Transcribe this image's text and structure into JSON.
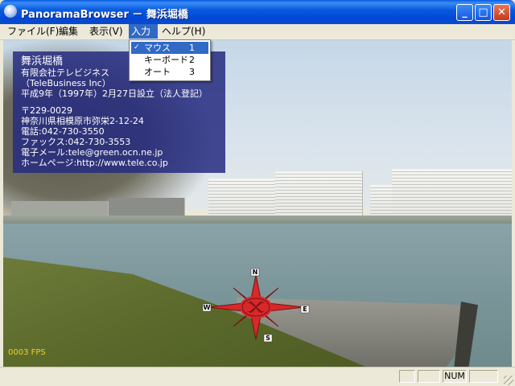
{
  "window": {
    "title": "PanoramaBrowser － 舞浜堀橋",
    "minimize_glyph": "_",
    "maximize_glyph": "□",
    "close_glyph": "✕"
  },
  "menu": {
    "items": [
      {
        "label": "ファイル(F)"
      },
      {
        "label": "編集"
      },
      {
        "label": "表示(V)"
      },
      {
        "label": "入力"
      },
      {
        "label": "ヘルプ(H)"
      }
    ]
  },
  "input_menu": {
    "items": [
      {
        "check": "✓",
        "label": "マウス",
        "key": "1",
        "selected": true
      },
      {
        "check": "",
        "label": "キーボード",
        "key": "2",
        "selected": false
      },
      {
        "check": "",
        "label": "オート",
        "key": "3",
        "selected": false
      }
    ]
  },
  "info": {
    "lines": [
      "舞浜堀橋",
      "有限会社テレビジネス",
      "（TeleBusiness Inc）",
      "平成9年（1997年）2月27日設立（法人登記）",
      "",
      "〒229-0029",
      "神奈川県相模原市弥栄2-12-24",
      "電話:042-730-3550",
      "ファックス:042-730-3553",
      "電子メール:tele@green.ocn.ne.jp",
      "ホームページ:http://www.tele.co.jp"
    ]
  },
  "viewer": {
    "fps": "0003 FPS",
    "compass": {
      "n": "N",
      "e": "E",
      "s": "S",
      "w": "W"
    }
  },
  "statusbar": {
    "panels": [
      "",
      "",
      "NUM",
      ""
    ]
  },
  "colors": {
    "title_blue": "#0a5be0",
    "menu_highlight": "#316ac5",
    "info_panel": "#262c80",
    "compass_red": "#d8282a"
  }
}
